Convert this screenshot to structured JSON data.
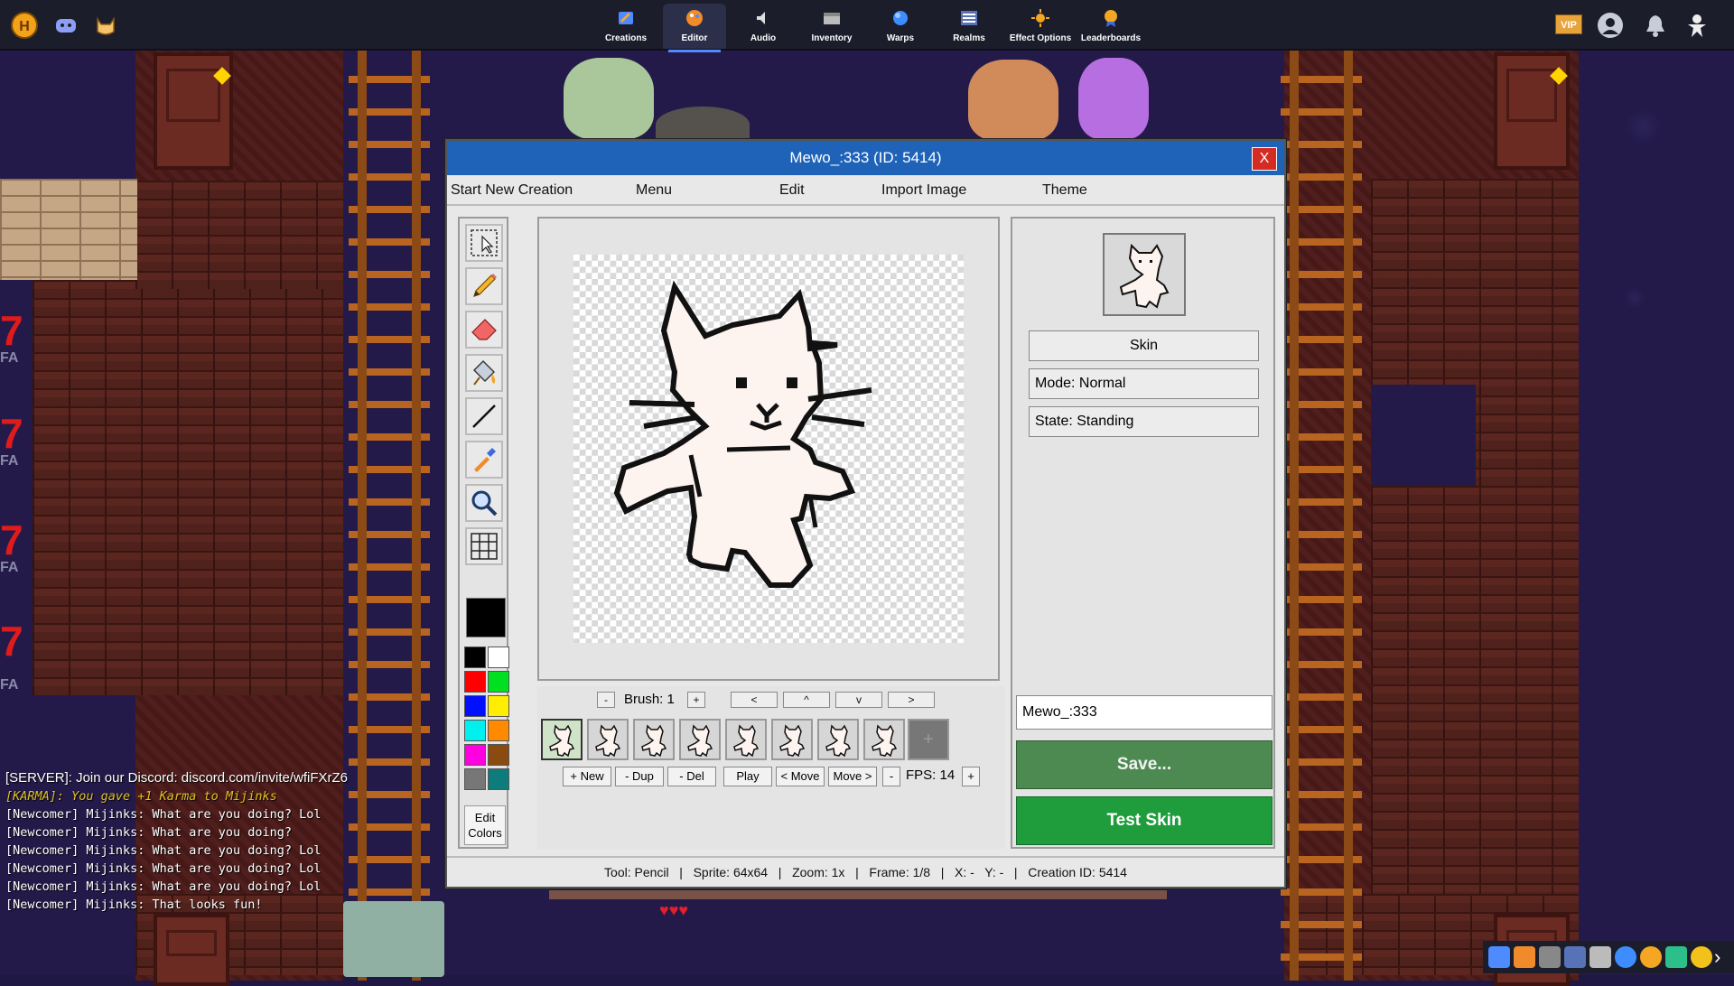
{
  "nav": {
    "items": [
      {
        "label": "Creations",
        "icon": "creations-icon"
      },
      {
        "label": "Editor",
        "icon": "editor-icon",
        "active": true
      },
      {
        "label": "Audio",
        "icon": "audio-icon"
      },
      {
        "label": "Inventory",
        "icon": "inventory-icon"
      },
      {
        "label": "Warps",
        "icon": "warps-icon"
      },
      {
        "label": "Realms",
        "icon": "realms-icon"
      },
      {
        "label": "Effect Options",
        "icon": "effect-options-icon"
      },
      {
        "label": "Leaderboards",
        "icon": "leaderboards-icon"
      }
    ],
    "vip": "VIP"
  },
  "editor": {
    "title": "Mewo_:333 (ID: 5414)",
    "close": "X",
    "menu": [
      "Start New Creation",
      "Menu",
      "Edit",
      "Import Image",
      "Theme"
    ],
    "edit_colors": "Edit Colors",
    "palette": [
      "#000000",
      "#ffffff",
      "#ff0000",
      "#00e020",
      "#0010ff",
      "#ffee00",
      "#00f0f0",
      "#ff8a00",
      "#ff00e0",
      "#8a4b10",
      "#777777",
      "#0e7c7b"
    ],
    "current_color": "#000000",
    "brush": {
      "minus": "-",
      "label": "Brush: 1",
      "plus": "+"
    },
    "nudge": [
      "<",
      "^",
      "v",
      ">"
    ],
    "frames_count": 8,
    "add_frame": "+",
    "actions": [
      "+ New",
      "- Dup",
      "- Del",
      "Play",
      "< Move",
      "Move >"
    ],
    "fps": {
      "minus": "-",
      "label": "FPS: 14",
      "plus": "+"
    },
    "right": {
      "type_button": "Skin",
      "mode": "Mode: Normal",
      "state": "State: Standing",
      "name_value": "Mewo_:333",
      "save": "Save...",
      "test": "Test Skin"
    },
    "status": "Tool: Pencil   |   Sprite: 64x64   |   Zoom: 1x   |   Frame: 1/8   |   X: -   Y: -   |   Creation ID: 5414"
  },
  "chat": [
    {
      "cls": "server",
      "text": "[SERVER]: Join our Discord: discord.com/invite/wfiFXrZ6"
    },
    {
      "cls": "karma",
      "text": "[KARMA]: You gave +1 Karma to Mijinks"
    },
    {
      "cls": "",
      "text": "[Newcomer] Mijinks: What are you doing? Lol"
    },
    {
      "cls": "",
      "text": "[Newcomer] Mijinks: What are you doing?"
    },
    {
      "cls": "",
      "text": "[Newcomer] Mijinks: What are you doing? Lol"
    },
    {
      "cls": "",
      "text": "[Newcomer] Mijinks: What are you doing? Lol"
    },
    {
      "cls": "",
      "text": "[Newcomer] Mijinks: What are you doing? Lol"
    },
    {
      "cls": "",
      "text": "[Newcomer] Mijinks: That looks fun!"
    }
  ],
  "background_labels": {
    "fa": "FA",
    "mark": "7",
    "hearts": "♥♥♥"
  }
}
